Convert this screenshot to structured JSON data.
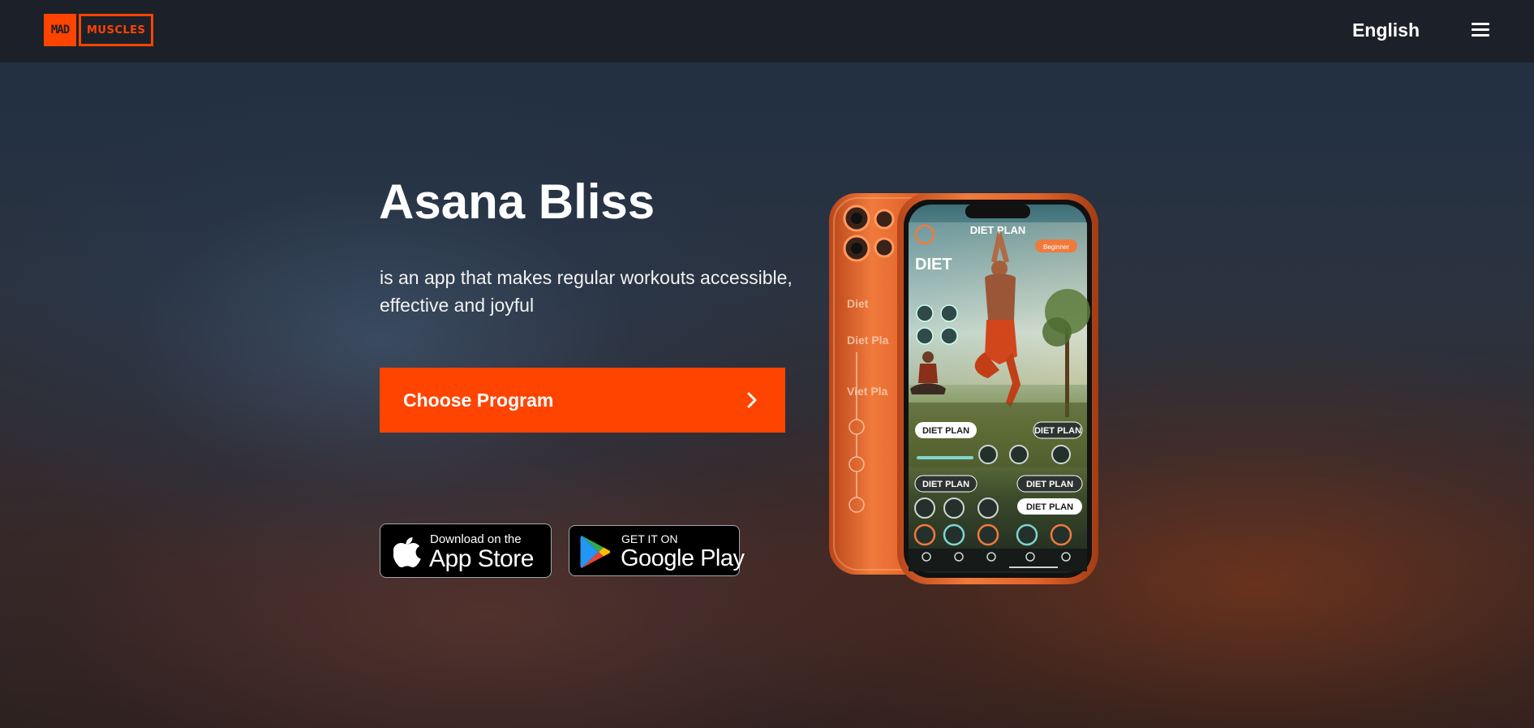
{
  "header": {
    "logo": {
      "mad_text": "MAD",
      "muscles_text": "MUSCLES"
    },
    "language_label": "English",
    "menu_icon": "hamburger-menu-icon"
  },
  "hero": {
    "title": "Asana Bliss",
    "subtitle": "is an app that makes regular workouts accessible, effective and joyful",
    "cta_label": "Choose Program",
    "cta_icon": "chevron-right-icon"
  },
  "stores": {
    "apple": {
      "small_text": "Download on the",
      "big_text": "App Store",
      "icon": "apple-icon"
    },
    "google": {
      "small_text": "GET IT ON",
      "big_text": "Google Play",
      "icon": "google-play-icon"
    }
  },
  "phone_screen": {
    "header_title": "DIET PLAN",
    "badge_text": "Beginner",
    "big_label": "DIET",
    "pill_labels": [
      "DIET PLAN",
      "DIET PLAN",
      "DIET PLAN",
      "DIET PLAN",
      "DIET PLAN"
    ],
    "back_labels": [
      "Diet",
      "Diet Pla",
      "Viet Pla"
    ]
  },
  "colors": {
    "accent": "#ff4400",
    "header_bg": "#1c2129",
    "phone_orange": "#e8672e"
  }
}
